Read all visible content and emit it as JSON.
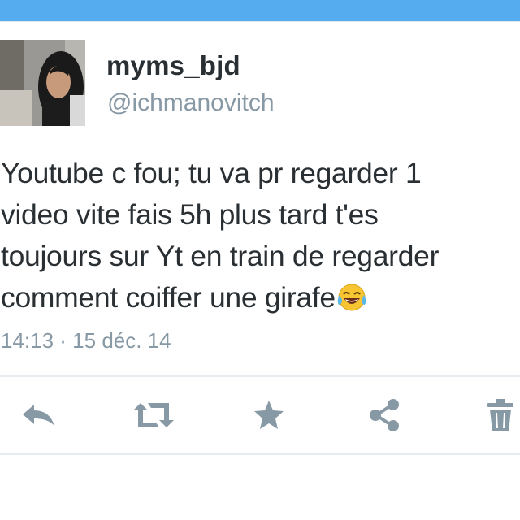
{
  "tweet": {
    "author": {
      "display_name": "myms_bjd",
      "handle": "@ichmanovitch"
    },
    "text_lines": [
      "Youtube c fou; tu va pr regarder 1",
      "video vite fais 5h plus tard t'es",
      "toujours sur Yt en train de regarder",
      "comment coiffer une girafe"
    ],
    "emoji": "face-with-tears-of-joy",
    "timestamp": "14:13 · 15 déc. 14"
  },
  "actions": [
    {
      "name": "reply",
      "icon": "reply-icon"
    },
    {
      "name": "retweet",
      "icon": "retweet-icon"
    },
    {
      "name": "favorite",
      "icon": "star-icon"
    },
    {
      "name": "share",
      "icon": "share-icon"
    },
    {
      "name": "delete",
      "icon": "trash-icon"
    }
  ],
  "colors": {
    "header_bar": "#55acee",
    "text": "#292f33",
    "secondary_text": "#8899a6",
    "action_icons": "#8899a6",
    "divider": "#e6ecf0"
  }
}
